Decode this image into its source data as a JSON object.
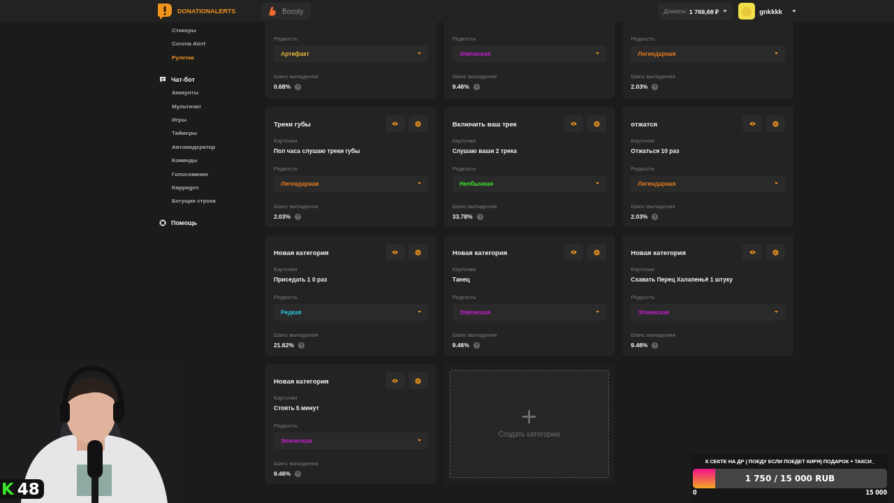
{
  "header": {
    "logo": "DONATIONALERTS",
    "tabs": [
      {
        "label": "Boosty",
        "selected": false
      }
    ],
    "donations": {
      "label": "Донаты:",
      "amount": "1 769,68 ₽"
    },
    "user": {
      "name": "gnkkkk"
    }
  },
  "sidebar": {
    "sections": [
      {
        "items": [
          {
            "label": "Стикеры",
            "selected": false
          },
          {
            "label": "Corona Alert",
            "selected": false
          },
          {
            "label": "Рулетка",
            "selected": true
          }
        ]
      },
      {
        "kind": "chat",
        "label": "Чат-бот",
        "items": [
          {
            "label": "Аккаунты",
            "selected": false
          },
          {
            "label": "Мультичат",
            "selected": false
          },
          {
            "label": "Игры",
            "selected": false
          },
          {
            "label": "Таймеры",
            "selected": false
          },
          {
            "label": "Автомодератор",
            "selected": false
          },
          {
            "label": "Команды",
            "selected": false
          },
          {
            "label": "Голосования",
            "selected": false
          },
          {
            "label": "Kappagen",
            "selected": false
          },
          {
            "label": "Бегущая строка",
            "selected": false
          }
        ]
      },
      {
        "kind": "help",
        "label": "Помощь"
      }
    ]
  },
  "categories": [
    {
      "rarity_label": "Редкость",
      "rarity": "Артефакт",
      "color": "#e2b53c",
      "chance_label": "Шанс выпадения",
      "chance": "0.68%"
    },
    {
      "rarity_label": "Редкость",
      "rarity": "Эпическая",
      "color": "#c020c8",
      "chance_label": "Шанс выпадения",
      "chance": "9.46%"
    },
    {
      "rarity_label": "Редкость",
      "rarity": "Легендарная",
      "color": "#e07a22",
      "chance_label": "Шанс выпадения",
      "chance": "2.03%"
    },
    {
      "title": "Треки губы",
      "cards_label": "Карточки",
      "cards": "Пол часа слушаю треки губы",
      "rarity_label": "Редкость",
      "rarity": "Легендарная",
      "color": "#e07a22",
      "chance_label": "Шанс выпадения",
      "chance": "2.03%"
    },
    {
      "title": "Включить ваш трек",
      "cards_label": "Карточки",
      "cards": "Слушаю ваши 2 трека",
      "rarity_label": "Редкость",
      "rarity": "Необычная",
      "color": "#3fd92c",
      "chance_label": "Шанс выпадения",
      "chance": "33.78%"
    },
    {
      "title": "отжатся",
      "cards_label": "Карточки",
      "cards": "Отжаться 10 раз",
      "rarity_label": "Редкость",
      "rarity": "Легендарная",
      "color": "#e07a22",
      "chance_label": "Шанс выпадения",
      "chance": "2.03%"
    },
    {
      "title": "Новая категория",
      "cards_label": "Карточки",
      "cards": "Приседать 1 0 раз",
      "rarity_label": "Редкость",
      "rarity": "Редкая",
      "color": "#2cbcd6",
      "chance_label": "Шанс выпадения",
      "chance": "21.62%"
    },
    {
      "title": "Новая категория",
      "cards_label": "Карточки",
      "cards": "Танец",
      "rarity_label": "Редкость",
      "rarity": "Эпическая",
      "color": "#c020c8",
      "chance_label": "Шанс выпадения",
      "chance": "9.46%"
    },
    {
      "title": "Новая категория",
      "cards_label": "Карточки",
      "cards": "Схавать Перец Халапеньё 1 штуку",
      "rarity_label": "Редкость",
      "rarity": "Эпическая",
      "color": "#c020c8",
      "chance_label": "Шанс выпадения",
      "chance": "9.46%"
    },
    {
      "title": "Новая категория",
      "cards_label": "Карточки",
      "cards": "Стоять 5 минут",
      "rarity_label": "Редкость",
      "rarity": "Эпическая",
      "color": "#c020c8",
      "chance_label": "Шанс выпадения",
      "chance": "9.46%"
    }
  ],
  "create_category": {
    "label": "Создать категорию"
  },
  "webcam": {
    "kind": "picture",
    "badge": {
      "letter": "K",
      "count": "48"
    }
  },
  "donation_goal": {
    "title": "К СЕКТЕ НА ДР ( ПОЕДУ ЕСЛИ ПОЕДЕТ КИРЯ) ПОДАРОК + ТАКСИ_",
    "progress": "1 750 / 15 000 RUB",
    "level": 0.1167,
    "min": "0",
    "max": "15 000"
  }
}
